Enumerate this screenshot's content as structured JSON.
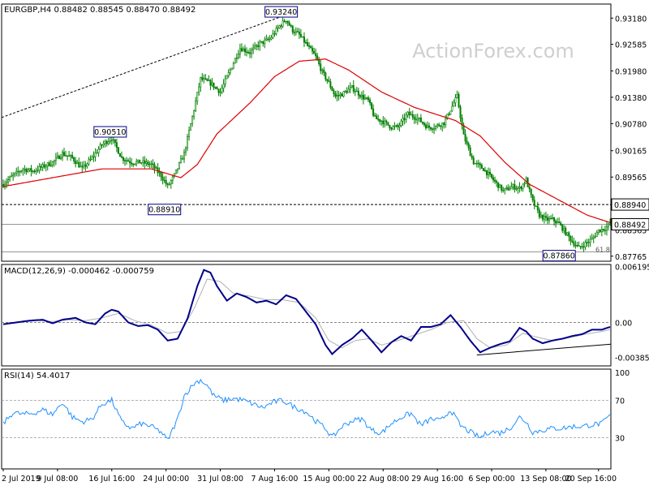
{
  "header": {
    "symbol_line": "EURGBP,H4  0.88482 0.88545 0.88470 0.88492",
    "watermark": "ActionForex.com"
  },
  "colors": {
    "bull": "#008000",
    "bear": "#008000",
    "ma": "#dd0000",
    "macd": "#00008b",
    "signal": "#b0b0b0",
    "rsi": "#1e90ff",
    "frame": "#000000",
    "levels": "#000000",
    "trend": "#000000"
  },
  "chart_data": [
    {
      "name": "price",
      "type": "candlestick",
      "ylim": [
        0.8765,
        0.935
      ],
      "y_ticks": [
        "0.93180",
        "0.92585",
        "0.91980",
        "0.91380",
        "0.90780",
        "0.90165",
        "0.89565",
        "0.88365",
        "0.87765"
      ],
      "x_ticks": [
        "2 Jul 2019",
        "9 Jul 08:00",
        "16 Jul 16:00",
        "24 Jul 00:00",
        "31 Jul 08:00",
        "7 Aug 16:00",
        "15 Aug 00:00",
        "22 Aug 08:00",
        "29 Aug 16:00",
        "6 Sep 00:00",
        "13 Sep 08:00",
        "20 Sep 16:00"
      ],
      "anchors": [
        [
          0,
          0.894
        ],
        [
          6,
          0.896
        ],
        [
          12,
          0.8975
        ],
        [
          18,
          0.897
        ],
        [
          24,
          0.898
        ],
        [
          30,
          0.899
        ],
        [
          36,
          0.901
        ],
        [
          42,
          0.9
        ],
        [
          48,
          0.8975
        ],
        [
          54,
          0.9
        ],
        [
          60,
          0.903
        ],
        [
          66,
          0.9045
        ],
        [
          72,
          0.9
        ],
        [
          78,
          0.899
        ],
        [
          84,
          0.899
        ],
        [
          90,
          0.8985
        ],
        [
          96,
          0.896
        ],
        [
          100,
          0.8935
        ],
        [
          104,
          0.896
        ],
        [
          110,
          0.901
        ],
        [
          116,
          0.911
        ],
        [
          120,
          0.918
        ],
        [
          126,
          0.917
        ],
        [
          132,
          0.915
        ],
        [
          138,
          0.92
        ],
        [
          144,
          0.925
        ],
        [
          150,
          0.924
        ],
        [
          156,
          0.926
        ],
        [
          162,
          0.927
        ],
        [
          168,
          0.93
        ],
        [
          172,
          0.9315
        ],
        [
          176,
          0.929
        ],
        [
          180,
          0.928
        ],
        [
          186,
          0.925
        ],
        [
          190,
          0.923
        ],
        [
          194,
          0.9195
        ],
        [
          198,
          0.917
        ],
        [
          202,
          0.914
        ],
        [
          206,
          0.9145
        ],
        [
          212,
          0.916
        ],
        [
          218,
          0.914
        ],
        [
          222,
          0.913
        ],
        [
          226,
          0.909
        ],
        [
          230,
          0.9085
        ],
        [
          236,
          0.907
        ],
        [
          240,
          0.907
        ],
        [
          246,
          0.91
        ],
        [
          252,
          0.909
        ],
        [
          258,
          0.907
        ],
        [
          262,
          0.907
        ],
        [
          268,
          0.908
        ],
        [
          272,
          0.911
        ],
        [
          276,
          0.914
        ],
        [
          280,
          0.905
        ],
        [
          286,
          0.899
        ],
        [
          292,
          0.8975
        ],
        [
          298,
          0.895
        ],
        [
          304,
          0.8925
        ],
        [
          310,
          0.8935
        ],
        [
          314,
          0.893
        ],
        [
          318,
          0.895
        ],
        [
          322,
          0.89
        ],
        [
          326,
          0.887
        ],
        [
          330,
          0.886
        ],
        [
          334,
          0.886
        ],
        [
          338,
          0.885
        ],
        [
          342,
          0.883
        ],
        [
          346,
          0.881
        ],
        [
          350,
          0.8795
        ],
        [
          354,
          0.8805
        ],
        [
          358,
          0.8815
        ],
        [
          362,
          0.8835
        ],
        [
          366,
          0.884
        ],
        [
          369,
          0.8849
        ]
      ],
      "moving_average_anchors": [
        [
          0,
          0.8935
        ],
        [
          30,
          0.8955
        ],
        [
          60,
          0.8975
        ],
        [
          90,
          0.8975
        ],
        [
          108,
          0.8955
        ],
        [
          118,
          0.8985
        ],
        [
          130,
          0.9055
        ],
        [
          150,
          0.9125
        ],
        [
          165,
          0.9185
        ],
        [
          180,
          0.922
        ],
        [
          196,
          0.9225
        ],
        [
          210,
          0.92
        ],
        [
          230,
          0.915
        ],
        [
          250,
          0.9115
        ],
        [
          275,
          0.9085
        ],
        [
          290,
          0.905
        ],
        [
          305,
          0.899
        ],
        [
          320,
          0.894
        ],
        [
          340,
          0.89
        ],
        [
          355,
          0.887
        ],
        [
          369,
          0.8853
        ]
      ],
      "labels": [
        {
          "text": "0.93240",
          "x": 171,
          "y": 0.9324,
          "type": "high"
        },
        {
          "text": "0.90510",
          "x": 67,
          "y": 0.9051,
          "type": "high"
        },
        {
          "text": "0.88910",
          "x": 100,
          "y": 0.8891,
          "type": "low"
        },
        {
          "text": "0.87860",
          "x": 340,
          "y": 0.8786,
          "type": "low"
        }
      ],
      "hlines": [
        {
          "y": 0.8894,
          "label": "0.88940",
          "style": "dashed"
        },
        {
          "y": 0.8849,
          "label": "0.88492",
          "style": "solid"
        },
        {
          "y": 0.8786,
          "label": "",
          "style": "solid"
        }
      ],
      "trendline": {
        "from": [
          0,
          0.9092
        ],
        "to": [
          171,
          0.9324
        ]
      },
      "fib_label": "61.8"
    },
    {
      "name": "macd",
      "type": "line",
      "title": "MACD(12,26,9) -0.000462 -0.000759",
      "ylim": [
        -0.0048,
        0.0064
      ],
      "y_ticks": [
        "0.006195",
        "0.00",
        "-0.003851"
      ],
      "zero_line": 0,
      "macd_anchors": [
        [
          0,
          -0.0002
        ],
        [
          8,
          0.0
        ],
        [
          16,
          0.0002
        ],
        [
          24,
          0.0003
        ],
        [
          30,
          -0.0001
        ],
        [
          36,
          0.0003
        ],
        [
          44,
          0.0005
        ],
        [
          50,
          0.0
        ],
        [
          56,
          -0.0002
        ],
        [
          62,
          0.001
        ],
        [
          66,
          0.0014
        ],
        [
          70,
          0.0012
        ],
        [
          76,
          0.0
        ],
        [
          82,
          -0.0004
        ],
        [
          88,
          -0.0003
        ],
        [
          94,
          -0.0008
        ],
        [
          100,
          -0.002
        ],
        [
          106,
          -0.0018
        ],
        [
          112,
          0.0004
        ],
        [
          118,
          0.004
        ],
        [
          122,
          0.0058
        ],
        [
          126,
          0.0055
        ],
        [
          130,
          0.004
        ],
        [
          136,
          0.0024
        ],
        [
          142,
          0.0032
        ],
        [
          148,
          0.0028
        ],
        [
          154,
          0.0022
        ],
        [
          160,
          0.0024
        ],
        [
          166,
          0.002
        ],
        [
          172,
          0.003
        ],
        [
          178,
          0.0026
        ],
        [
          184,
          0.0012
        ],
        [
          190,
          -0.0002
        ],
        [
          196,
          -0.0025
        ],
        [
          200,
          -0.0035
        ],
        [
          206,
          -0.0025
        ],
        [
          212,
          -0.0018
        ],
        [
          218,
          -0.0008
        ],
        [
          224,
          -0.002
        ],
        [
          230,
          -0.0033
        ],
        [
          236,
          -0.0022
        ],
        [
          242,
          -0.0015
        ],
        [
          248,
          -0.002
        ],
        [
          254,
          -0.0005
        ],
        [
          260,
          -0.0005
        ],
        [
          266,
          -0.0002
        ],
        [
          272,
          0.0008
        ],
        [
          278,
          -0.0005
        ],
        [
          284,
          -0.002
        ],
        [
          290,
          -0.0033
        ],
        [
          296,
          -0.0028
        ],
        [
          302,
          -0.0024
        ],
        [
          308,
          -0.0021
        ],
        [
          314,
          -0.0006
        ],
        [
          318,
          -0.001
        ],
        [
          322,
          -0.0018
        ],
        [
          328,
          -0.0023
        ],
        [
          334,
          -0.002
        ],
        [
          340,
          -0.0018
        ],
        [
          346,
          -0.0015
        ],
        [
          352,
          -0.0013
        ],
        [
          358,
          -0.0008
        ],
        [
          364,
          -0.0008
        ],
        [
          369,
          -0.0005
        ]
      ],
      "signal_anchors": [
        [
          0,
          -0.0002
        ],
        [
          10,
          0.0
        ],
        [
          20,
          0.0002
        ],
        [
          30,
          0.0001
        ],
        [
          40,
          0.0003
        ],
        [
          50,
          0.0002
        ],
        [
          60,
          0.0005
        ],
        [
          70,
          0.001
        ],
        [
          80,
          0.0002
        ],
        [
          90,
          -0.0003
        ],
        [
          100,
          -0.0012
        ],
        [
          108,
          -0.001
        ],
        [
          116,
          0.0015
        ],
        [
          124,
          0.0048
        ],
        [
          132,
          0.0045
        ],
        [
          140,
          0.0032
        ],
        [
          150,
          0.0029
        ],
        [
          160,
          0.0025
        ],
        [
          170,
          0.0025
        ],
        [
          180,
          0.0022
        ],
        [
          190,
          0.0005
        ],
        [
          198,
          -0.002
        ],
        [
          206,
          -0.0028
        ],
        [
          214,
          -0.002
        ],
        [
          222,
          -0.0018
        ],
        [
          230,
          -0.0025
        ],
        [
          240,
          -0.002
        ],
        [
          250,
          -0.0014
        ],
        [
          260,
          -0.0008
        ],
        [
          270,
          0.0
        ],
        [
          280,
          0.0002
        ],
        [
          288,
          -0.0018
        ],
        [
          296,
          -0.0028
        ],
        [
          306,
          -0.0025
        ],
        [
          316,
          -0.0012
        ],
        [
          324,
          -0.0016
        ],
        [
          334,
          -0.002
        ],
        [
          344,
          -0.0017
        ],
        [
          354,
          -0.0013
        ],
        [
          364,
          -0.001
        ],
        [
          369,
          -0.0008
        ]
      ],
      "trendline": {
        "from": [
          288,
          -0.0036
        ],
        "to": [
          369,
          -0.0024
        ]
      }
    },
    {
      "name": "rsi",
      "type": "line",
      "title": "RSI(14) 54.4017",
      "ylim": [
        0,
        100
      ],
      "y_ticks": [
        "100",
        "70",
        "30"
      ],
      "levels": [
        70,
        30
      ],
      "rsi_anchors": [
        [
          0,
          45
        ],
        [
          6,
          57
        ],
        [
          12,
          55
        ],
        [
          18,
          56
        ],
        [
          24,
          60
        ],
        [
          30,
          55
        ],
        [
          36,
          68
        ],
        [
          42,
          52
        ],
        [
          48,
          47
        ],
        [
          54,
          50
        ],
        [
          60,
          66
        ],
        [
          66,
          70
        ],
        [
          72,
          47
        ],
        [
          78,
          40
        ],
        [
          84,
          45
        ],
        [
          90,
          42
        ],
        [
          96,
          36
        ],
        [
          100,
          27
        ],
        [
          106,
          50
        ],
        [
          110,
          75
        ],
        [
          116,
          88
        ],
        [
          120,
          92
        ],
        [
          124,
          86
        ],
        [
          128,
          75
        ],
        [
          134,
          70
        ],
        [
          140,
          72
        ],
        [
          146,
          70
        ],
        [
          152,
          66
        ],
        [
          158,
          62
        ],
        [
          164,
          68
        ],
        [
          170,
          70
        ],
        [
          174,
          66
        ],
        [
          178,
          62
        ],
        [
          184,
          58
        ],
        [
          190,
          48
        ],
        [
          196,
          40
        ],
        [
          200,
          30
        ],
        [
          206,
          42
        ],
        [
          212,
          48
        ],
        [
          218,
          50
        ],
        [
          224,
          38
        ],
        [
          230,
          35
        ],
        [
          236,
          45
        ],
        [
          242,
          52
        ],
        [
          248,
          56
        ],
        [
          254,
          43
        ],
        [
          260,
          50
        ],
        [
          266,
          48
        ],
        [
          272,
          60
        ],
        [
          278,
          43
        ],
        [
          284,
          36
        ],
        [
          290,
          30
        ],
        [
          296,
          37
        ],
        [
          302,
          35
        ],
        [
          308,
          40
        ],
        [
          314,
          52
        ],
        [
          318,
          47
        ],
        [
          322,
          36
        ],
        [
          328,
          38
        ],
        [
          334,
          40
        ],
        [
          340,
          40
        ],
        [
          346,
          42
        ],
        [
          352,
          42
        ],
        [
          358,
          44
        ],
        [
          364,
          45
        ],
        [
          369,
          54
        ]
      ]
    }
  ]
}
